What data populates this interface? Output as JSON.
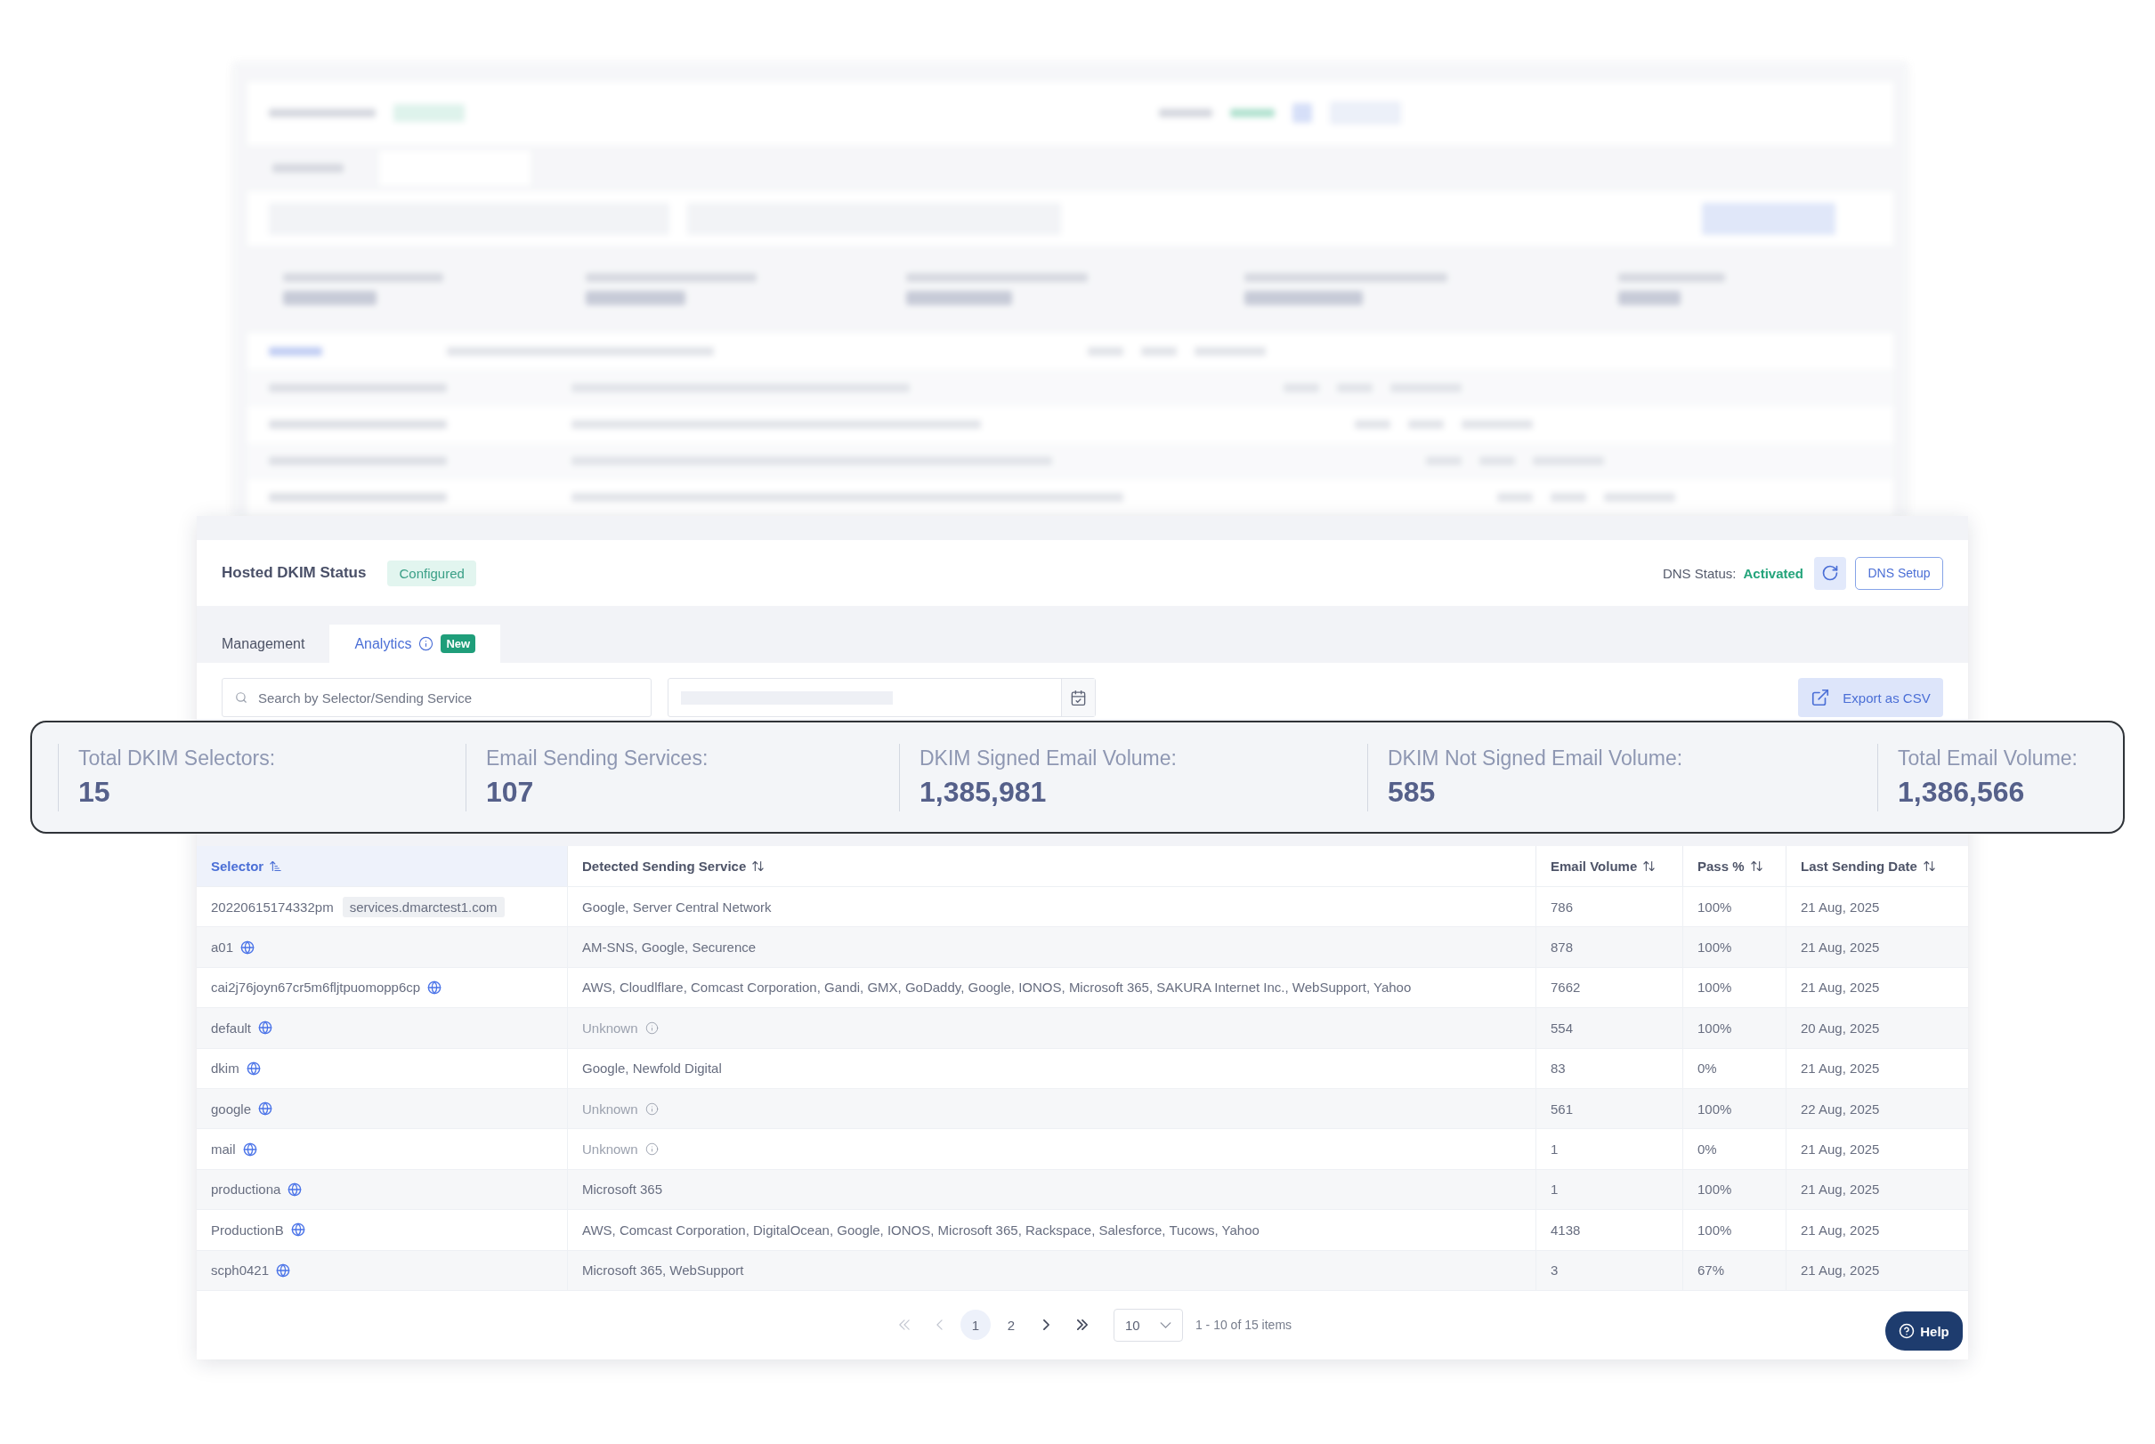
{
  "header": {
    "title": "Hosted DKIM Status",
    "status_badge": "Configured",
    "dns_label": "DNS Status:",
    "dns_value": "Activated",
    "dns_setup_button": "DNS Setup"
  },
  "tabs": [
    {
      "label": "Management",
      "selected": false,
      "info": false
    },
    {
      "label": "Analytics",
      "selected": true,
      "info": true,
      "badge": "New"
    }
  ],
  "filters": {
    "search_placeholder": "Search by Selector/Sending Service",
    "date_range": {
      "masked": true
    },
    "export_button": "Export as CSV"
  },
  "stats": [
    {
      "label": "Total DKIM Selectors:",
      "value": "15"
    },
    {
      "label": "Email Sending Services:",
      "value": "107"
    },
    {
      "label": "DKIM Signed Email Volume:",
      "value": "1,385,981"
    },
    {
      "label": "DKIM Not Signed Email Volume:",
      "value": "585"
    },
    {
      "label": "Total Email Volume:",
      "value": "1,386,566"
    }
  ],
  "table": {
    "columns": [
      {
        "label": "Selector",
        "sorted": true
      },
      {
        "label": "Detected Sending Service",
        "sorted": false
      },
      {
        "label": "Email Volume",
        "sorted": false
      },
      {
        "label": "Pass %",
        "sorted": false
      },
      {
        "label": "Last Sending Date",
        "sorted": false
      }
    ],
    "rows": [
      {
        "selector": "20220615174332pm",
        "domain": "services.dmarctest1.com",
        "globe": false,
        "services": "Google, Server Central Network",
        "unknown": false,
        "volume": "786",
        "pass": "100%",
        "last_date": "21 Aug, 2025"
      },
      {
        "selector": "a01",
        "globe": true,
        "services": "AM-SNS, Google, Securence",
        "unknown": false,
        "volume": "878",
        "pass": "100%",
        "last_date": "21 Aug, 2025"
      },
      {
        "selector": "cai2j76joyn67cr5m6fljtpuomopp6cp",
        "globe": true,
        "services": "AWS, Cloudlflare, Comcast Corporation, Gandi, GMX, GoDaddy, Google, IONOS, Microsoft 365, SAKURA Internet Inc., WebSupport, Yahoo",
        "unknown": false,
        "volume": "7662",
        "pass": "100%",
        "last_date": "21 Aug, 2025"
      },
      {
        "selector": "default",
        "globe": true,
        "services": "Unknown",
        "unknown": true,
        "volume": "554",
        "pass": "100%",
        "last_date": "20 Aug, 2025"
      },
      {
        "selector": "dkim",
        "globe": true,
        "services": "Google, Newfold Digital",
        "unknown": false,
        "volume": "83",
        "pass": "0%",
        "last_date": "21 Aug, 2025"
      },
      {
        "selector": "google",
        "globe": true,
        "services": "Unknown",
        "unknown": true,
        "volume": "561",
        "pass": "100%",
        "last_date": "22 Aug, 2025"
      },
      {
        "selector": "mail",
        "globe": true,
        "services": "Unknown",
        "unknown": true,
        "volume": "1",
        "pass": "0%",
        "last_date": "21 Aug, 2025"
      },
      {
        "selector": "productiona",
        "globe": true,
        "services": "Microsoft 365",
        "unknown": false,
        "volume": "1",
        "pass": "100%",
        "last_date": "21 Aug, 2025"
      },
      {
        "selector": "ProductionB",
        "globe": true,
        "services": "AWS, Comcast Corporation, DigitalOcean, Google, IONOS, Microsoft 365, Rackspace, Salesforce, Tucows, Yahoo",
        "unknown": false,
        "volume": "4138",
        "pass": "100%",
        "last_date": "21 Aug, 2025"
      },
      {
        "selector": "scph0421",
        "globe": true,
        "services": "Microsoft 365, WebSupport",
        "unknown": false,
        "volume": "3",
        "pass": "67%",
        "last_date": "21 Aug, 2025"
      }
    ]
  },
  "pagination": {
    "controls": [
      {
        "kind": "first",
        "disabled": true
      },
      {
        "kind": "prev",
        "disabled": true
      },
      {
        "kind": "page",
        "label": "1",
        "selected": true
      },
      {
        "kind": "page",
        "label": "2",
        "selected": false
      },
      {
        "kind": "next",
        "disabled": false
      },
      {
        "kind": "last",
        "disabled": false
      }
    ],
    "page_size": "10",
    "summary": "1 - 10 of 15 items"
  },
  "help_button": "Help"
}
